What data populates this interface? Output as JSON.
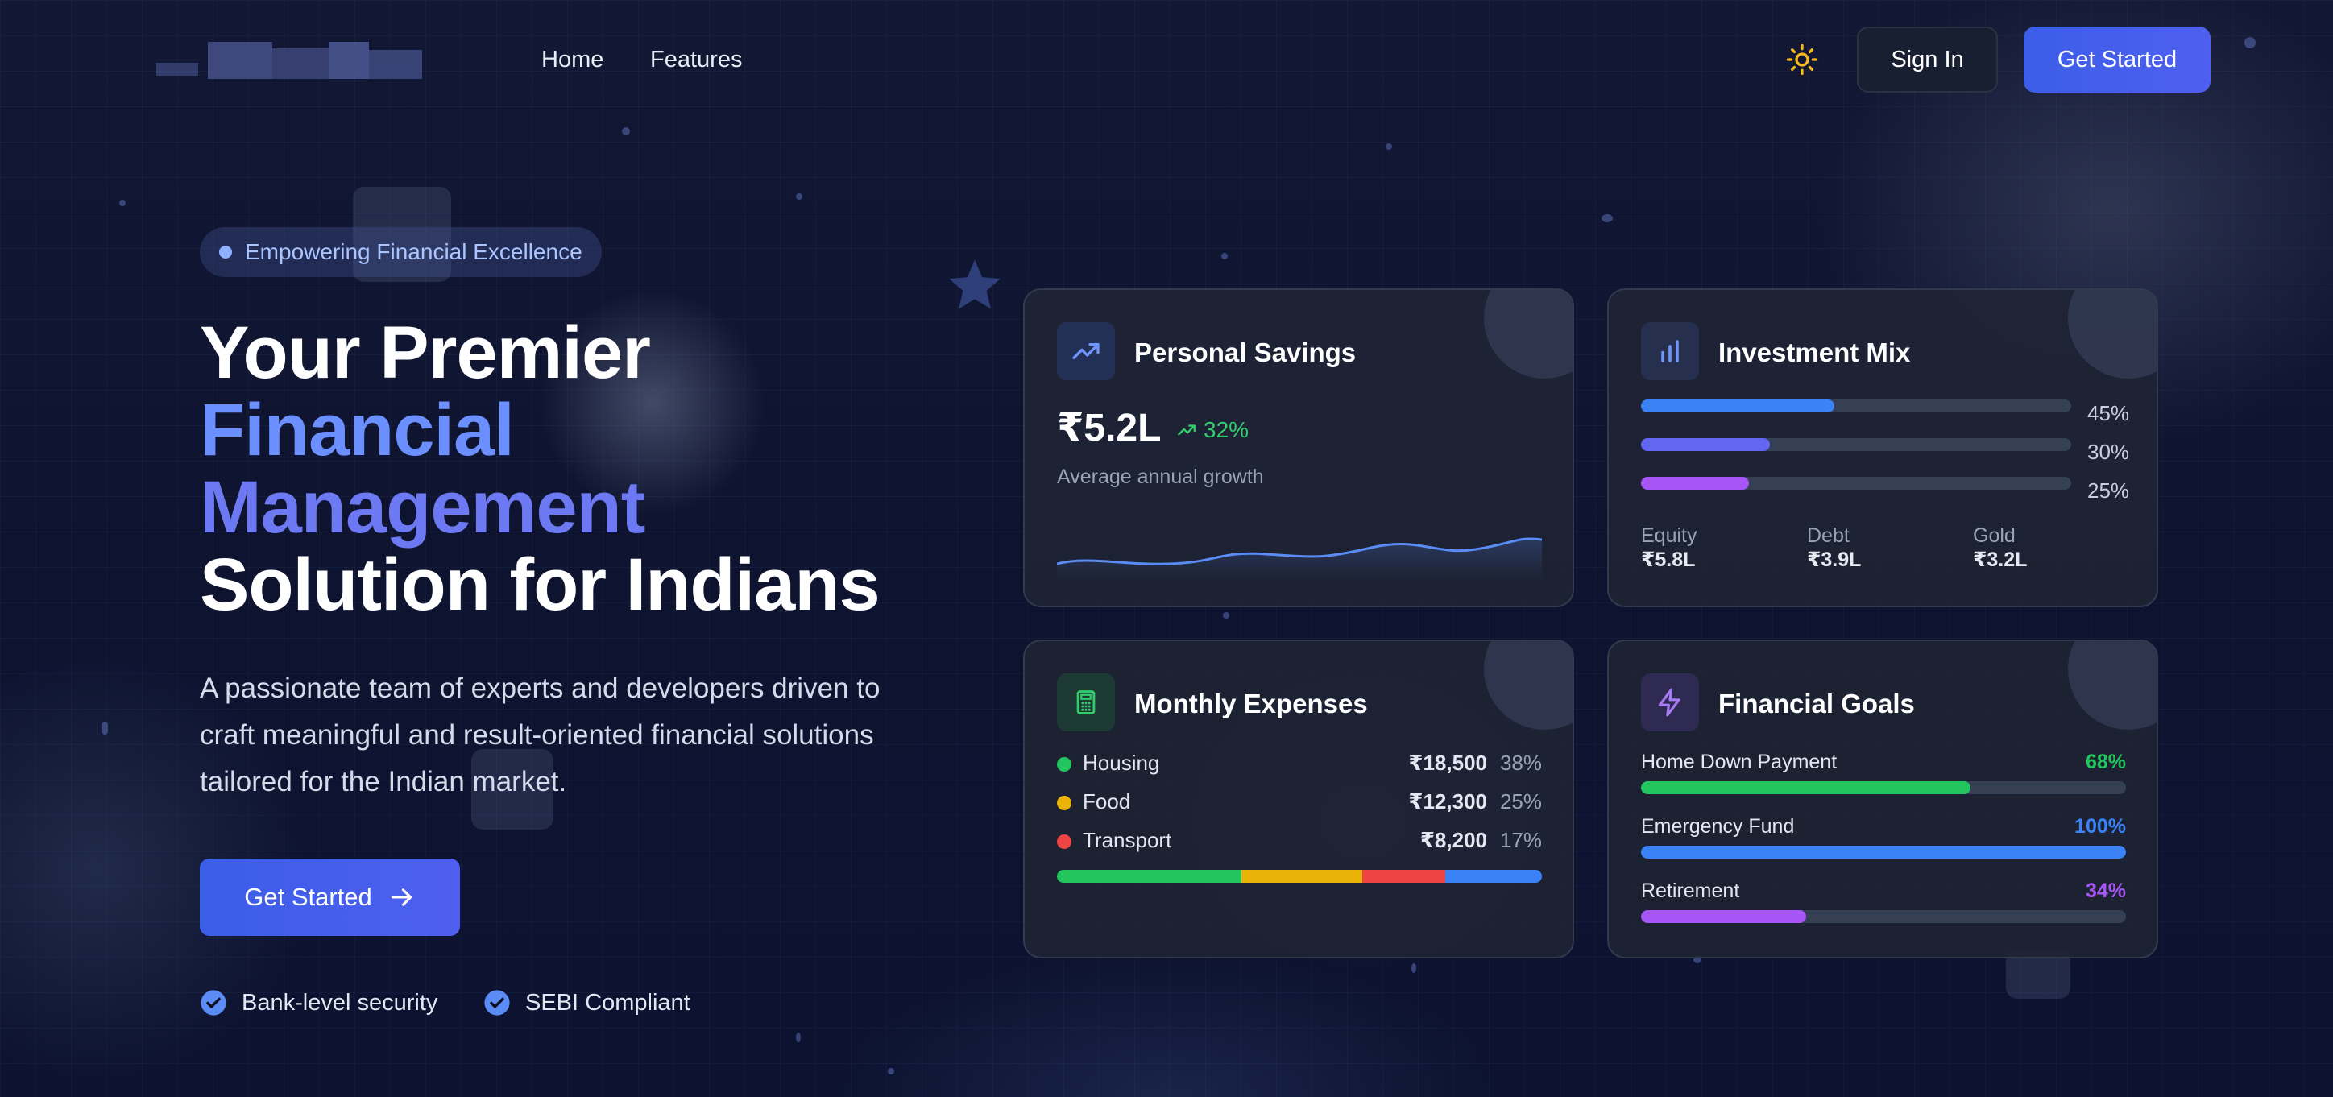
{
  "nav": {
    "links": [
      "Home",
      "Features"
    ],
    "sign_in": "Sign In",
    "get_started": "Get Started"
  },
  "hero": {
    "badge": "Empowering Financial Excellence",
    "title_line1": "Your Premier",
    "title_line2": "Financial",
    "title_line3": "Management",
    "title_line4": "Solution for Indians",
    "description": "A passionate team of experts and developers driven to craft meaningful and result-oriented financial solutions tailored for the Indian market.",
    "cta": "Get Started",
    "features": [
      "Bank-level security",
      "SEBI Compliant"
    ]
  },
  "cards": {
    "savings": {
      "title": "Personal Savings",
      "value": "₹5.2L",
      "growth": "32%",
      "subtitle": "Average annual growth"
    },
    "investment": {
      "title": "Investment Mix",
      "bars": [
        {
          "percent": 45,
          "label": "45%",
          "color": "#3b82f6"
        },
        {
          "percent": 30,
          "label": "30%",
          "color": "#6366f1"
        },
        {
          "percent": 25,
          "label": "25%",
          "color": "#a855f7"
        }
      ],
      "allocations": [
        {
          "name": "Equity",
          "value": "₹5.8L"
        },
        {
          "name": "Debt",
          "value": "₹3.9L"
        },
        {
          "name": "Gold",
          "value": "₹3.2L"
        }
      ]
    },
    "expenses": {
      "title": "Monthly Expenses",
      "items": [
        {
          "name": "Housing",
          "amount": "₹18,500",
          "percent": "38%",
          "color": "#22c55e"
        },
        {
          "name": "Food",
          "amount": "₹12,300",
          "percent": "25%",
          "color": "#eab308"
        },
        {
          "name": "Transport",
          "amount": "₹8,200",
          "percent": "17%",
          "color": "#ef4444"
        }
      ],
      "bar_segments": [
        {
          "share": 38,
          "color": "#22c55e"
        },
        {
          "share": 25,
          "color": "#eab308"
        },
        {
          "share": 17,
          "color": "#ef4444"
        },
        {
          "share": 20,
          "color": "#3b82f6"
        }
      ]
    },
    "goals": {
      "title": "Financial Goals",
      "items": [
        {
          "name": "Home Down Payment",
          "percent": 68,
          "label": "68%",
          "color": "#22c55e"
        },
        {
          "name": "Emergency Fund",
          "percent": 100,
          "label": "100%",
          "color": "#3b82f6"
        },
        {
          "name": "Retirement",
          "percent": 34,
          "label": "34%",
          "color": "#a855f7"
        }
      ]
    }
  },
  "colors": {
    "accent": "#3b5ee8",
    "success": "#2fce6a",
    "title_gradient": "#6b8fff"
  },
  "icons": {
    "theme": "sun-icon",
    "savings": "trending-up-icon",
    "investment": "bar-chart-icon",
    "expenses": "calculator-icon",
    "goals": "lightning-icon",
    "cta": "arrow-right-icon",
    "features": "check-badge-icon"
  }
}
